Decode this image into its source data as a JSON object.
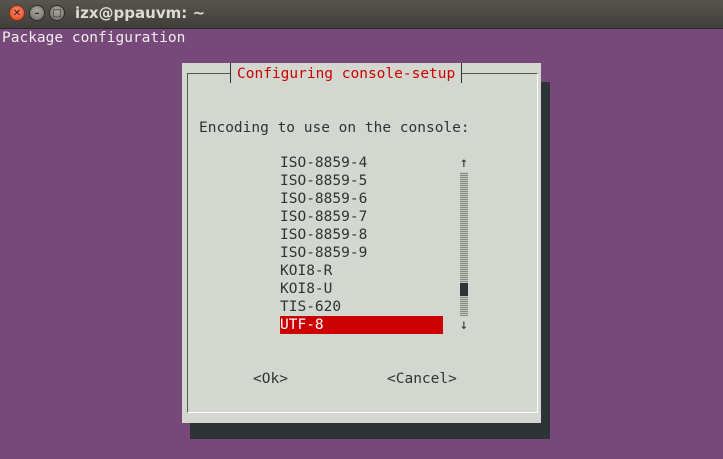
{
  "window": {
    "title": "izx@ppauvm: ~",
    "close_glyph": "✕",
    "minimize_glyph": "–",
    "maximize_glyph": "□"
  },
  "terminal": {
    "header_line": "Package configuration"
  },
  "dialog": {
    "title": "Configuring console-setup",
    "prompt": "Encoding to use on the console:",
    "options": [
      {
        "label": "ISO-8859-4",
        "selected": false
      },
      {
        "label": "ISO-8859-5",
        "selected": false
      },
      {
        "label": "ISO-8859-6",
        "selected": false
      },
      {
        "label": "ISO-8859-7",
        "selected": false
      },
      {
        "label": "ISO-8859-8",
        "selected": false
      },
      {
        "label": "ISO-8859-9",
        "selected": false
      },
      {
        "label": "KOI8-R",
        "selected": false
      },
      {
        "label": "KOI8-U",
        "selected": false
      },
      {
        "label": "TIS-620",
        "selected": false
      },
      {
        "label": "UTF-8",
        "selected": true
      }
    ],
    "scroll_up_glyph": "↑",
    "scroll_down_glyph": "↓",
    "ok_label": "<Ok>",
    "cancel_label": "<Cancel>"
  },
  "colors": {
    "terminal_background": "#77497a",
    "dialog_background": "#d3d7cf",
    "accent_red": "#cc0000",
    "shadow": "#2e3436"
  }
}
